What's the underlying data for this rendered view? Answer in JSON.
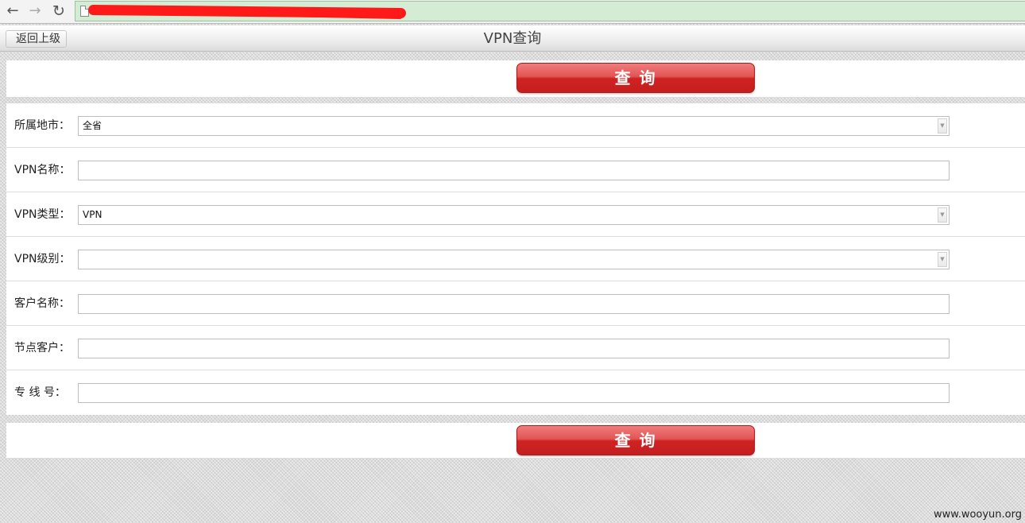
{
  "browser": {
    "back_icon": "←",
    "forward_icon": "→",
    "reload_icon": "↻"
  },
  "header": {
    "back_label": "返回上级",
    "title": "VPN查询"
  },
  "actions": {
    "query_label": "查 询"
  },
  "form": {
    "fields": [
      {
        "label": "所属地市：",
        "type": "select",
        "value": "全省"
      },
      {
        "label": "VPN名称：",
        "type": "text",
        "value": ""
      },
      {
        "label": "VPN类型：",
        "type": "select",
        "value": "VPN"
      },
      {
        "label": "VPN级别：",
        "type": "select",
        "value": ""
      },
      {
        "label": "客户名称：",
        "type": "text",
        "value": ""
      },
      {
        "label": "节点客户：",
        "type": "text",
        "value": ""
      },
      {
        "label": "专 线 号：",
        "type": "text",
        "value": ""
      }
    ]
  },
  "watermark": "www.wooyun.org",
  "colors": {
    "query_button": "#c41e1e",
    "address_bar": "#d3ecd3",
    "redaction": "#ff1a1a"
  }
}
